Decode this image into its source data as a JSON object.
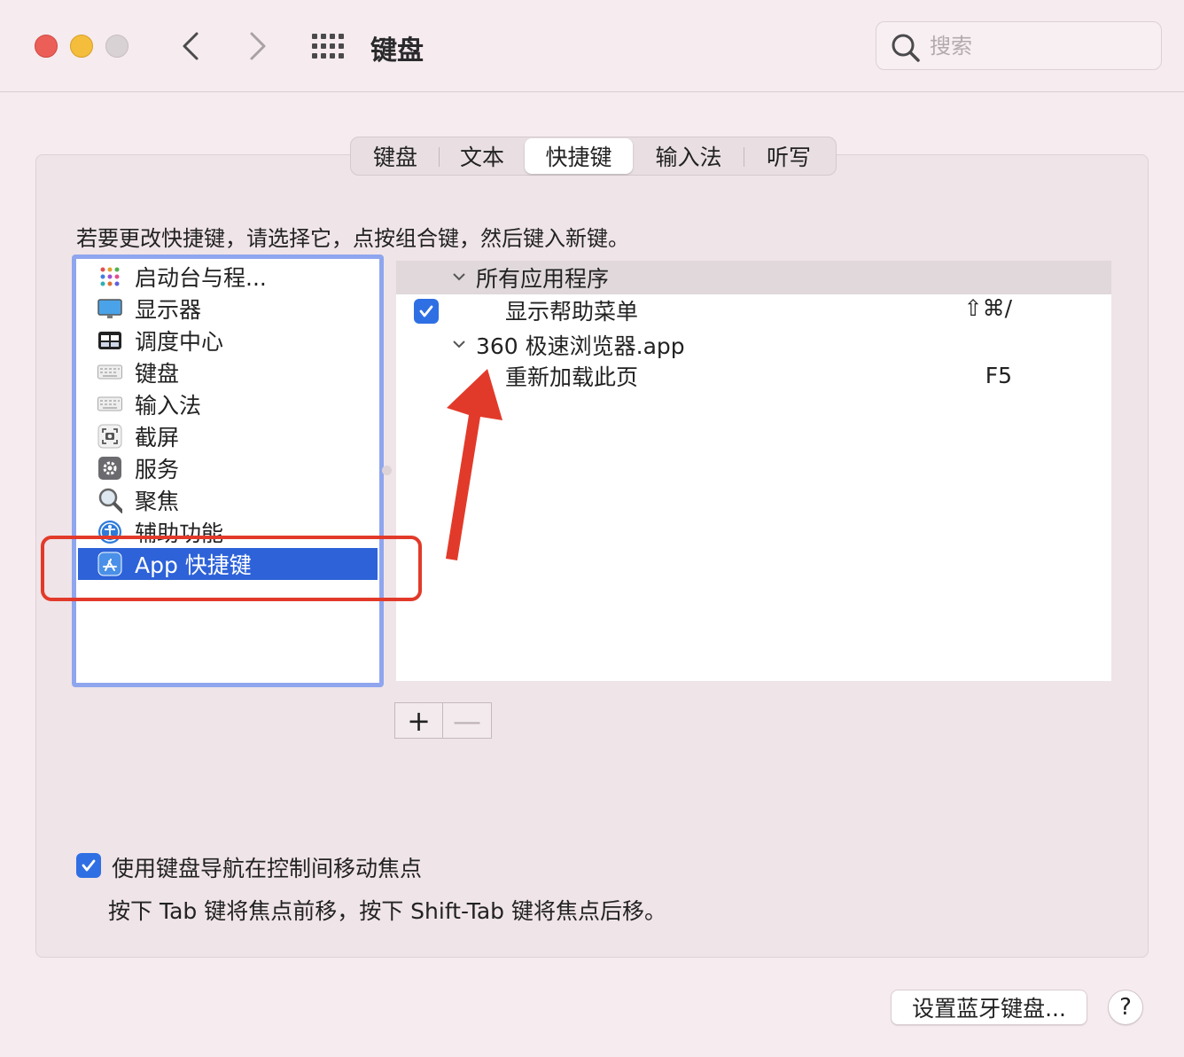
{
  "window": {
    "title": "键盘",
    "search_placeholder": "搜索"
  },
  "tabs": [
    {
      "label": "键盘",
      "active": false
    },
    {
      "label": "文本",
      "active": false
    },
    {
      "label": "快捷键",
      "active": true
    },
    {
      "label": "输入法",
      "active": false
    },
    {
      "label": "听写",
      "active": false
    }
  ],
  "instruction": "若要更改快捷键，请选择它，点按组合键，然后键入新键。",
  "categories": [
    {
      "label": "启动台与程...",
      "icon": "launchpad-icon"
    },
    {
      "label": "显示器",
      "icon": "display-icon"
    },
    {
      "label": "调度中心",
      "icon": "mission-control-icon"
    },
    {
      "label": "键盘",
      "icon": "keyboard-icon"
    },
    {
      "label": "输入法",
      "icon": "input-method-icon"
    },
    {
      "label": "截屏",
      "icon": "screenshot-icon"
    },
    {
      "label": "服务",
      "icon": "services-gear-icon"
    },
    {
      "label": "聚焦",
      "icon": "spotlight-magnifier-icon"
    },
    {
      "label": "辅助功能",
      "icon": "accessibility-icon"
    },
    {
      "label": "App 快捷键",
      "icon": "app-store-icon",
      "selected": true
    }
  ],
  "shortcuts": {
    "group1": "所有应用程序",
    "item1": {
      "label": "显示帮助菜单",
      "key": "⇧⌘/",
      "checked": true
    },
    "group2": "360 极速浏览器.app",
    "item2": {
      "label": "重新加载此页",
      "key": "F5"
    }
  },
  "add_label": "+",
  "remove_label": "—",
  "keyboard_nav": {
    "label": "使用键盘导航在控制间移动焦点",
    "checked": true,
    "hint": "按下 Tab 键将焦点前移，按下 Shift-Tab 键将焦点后移。"
  },
  "bluetooth_button": "设置蓝牙键盘...",
  "help_button": "?",
  "colors": {
    "selection": "#2d62d8",
    "accent_checkbox": "#2f6fe4",
    "annotation": "#e23a2a"
  }
}
